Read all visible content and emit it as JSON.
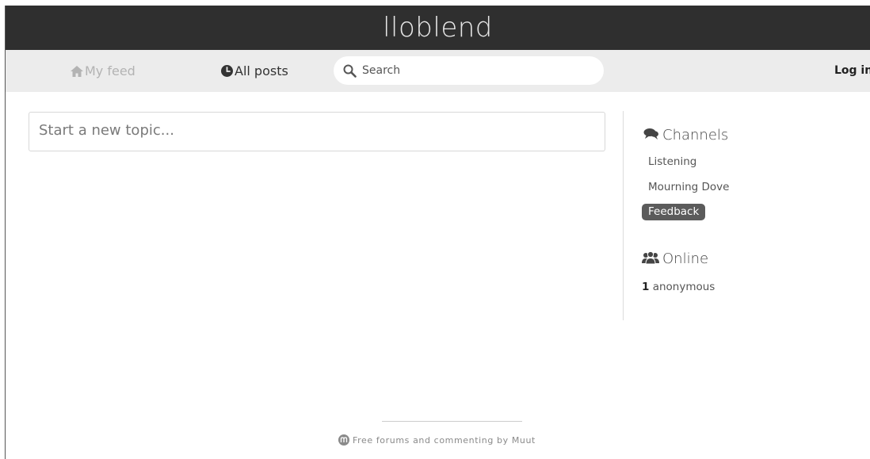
{
  "header": {
    "title": "lloblend"
  },
  "nav": {
    "my_feed": "My feed",
    "all_posts": "All posts",
    "search_placeholder": "Search",
    "login": "Log in"
  },
  "composer": {
    "placeholder": "Start a new topic..."
  },
  "sidebar": {
    "channels_title": "Channels",
    "channels": [
      {
        "label": "Listening",
        "active": false
      },
      {
        "label": "Mourning Dove",
        "active": false
      },
      {
        "label": "Feedback",
        "active": true
      }
    ],
    "online_title": "Online",
    "online_count": "1",
    "online_label": " anonymous"
  },
  "footer": {
    "text": "Free forums and commenting by Muut"
  },
  "colors": {
    "header_bg": "#2f2f2f",
    "nav_bg": "#ececec",
    "active_channel_bg": "#5b5b5b"
  }
}
